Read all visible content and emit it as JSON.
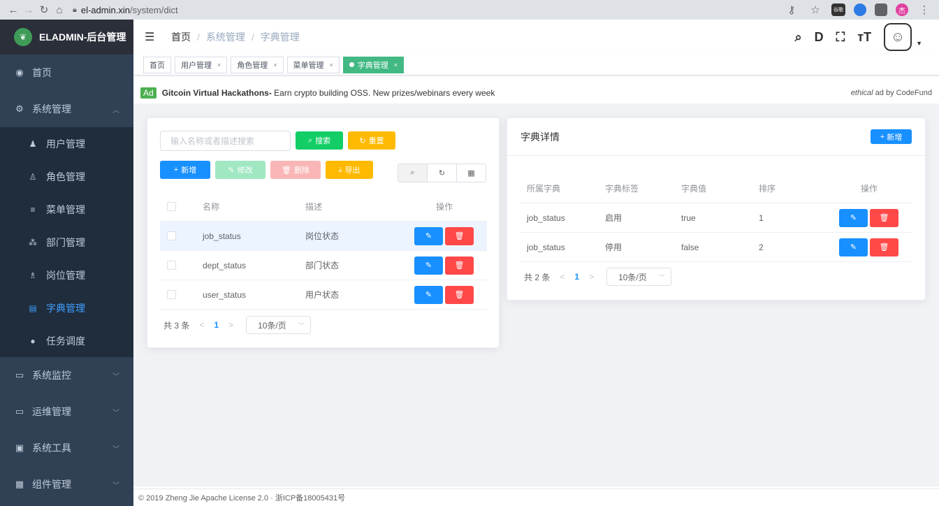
{
  "browser": {
    "url_host": "el-admin.xin",
    "url_path": "/system/dict",
    "ext_badge": "谷歌",
    "profile_initial": "杰"
  },
  "sidebar": {
    "logo_text": "ELADMIN-后台管理",
    "items": [
      {
        "label": "首页",
        "icon": "dashboard-icon"
      },
      {
        "label": "系统管理",
        "icon": "gear-icon",
        "expanded": true
      },
      {
        "label": "系统监控",
        "icon": "monitor-icon"
      },
      {
        "label": "运维管理",
        "icon": "ops-icon"
      },
      {
        "label": "系统工具",
        "icon": "tools-icon"
      },
      {
        "label": "组件管理",
        "icon": "components-icon"
      }
    ],
    "subitems": [
      {
        "label": "用户管理",
        "icon": "user-icon"
      },
      {
        "label": "角色管理",
        "icon": "role-icon"
      },
      {
        "label": "菜单管理",
        "icon": "menu-icon"
      },
      {
        "label": "部门管理",
        "icon": "dept-icon"
      },
      {
        "label": "岗位管理",
        "icon": "job-icon"
      },
      {
        "label": "字典管理",
        "icon": "dict-icon",
        "active": true
      },
      {
        "label": "任务调度",
        "icon": "timing-icon"
      }
    ]
  },
  "breadcrumb": [
    "首页",
    "系统管理",
    "字典管理"
  ],
  "tags": [
    "首页",
    "用户管理",
    "角色管理",
    "菜单管理",
    "字典管理"
  ],
  "ad": {
    "badge": "Ad",
    "headline": "Gitcoin Virtual Hackathons-",
    "text": " Earn crypto building OSS. New prizes/webinars every week",
    "right_em": "ethical",
    "right_text": " ad by CodeFund"
  },
  "dict": {
    "search_placeholder": "输入名称或者描述搜索",
    "search_label": "搜索",
    "reset_label": "重置",
    "add_label": "新增",
    "edit_label": "修改",
    "delete_label": "删除",
    "export_label": "导出",
    "columns": [
      "名称",
      "描述",
      "操作"
    ],
    "rows": [
      {
        "name": "job_status",
        "desc": "岗位状态"
      },
      {
        "name": "dept_status",
        "desc": "部门状态"
      },
      {
        "name": "user_status",
        "desc": "用户状态"
      }
    ],
    "total": "共 3 条",
    "page": "1",
    "page_size": "10条/页"
  },
  "detail": {
    "title": "字典详情",
    "add_label": "新增",
    "columns": [
      "所属字典",
      "字典标签",
      "字典值",
      "排序",
      "操作"
    ],
    "rows": [
      {
        "dict": "job_status",
        "label": "启用",
        "value": "true",
        "sort": "1"
      },
      {
        "dict": "job_status",
        "label": "停用",
        "value": "false",
        "sort": "2"
      }
    ],
    "total": "共 2 条",
    "page": "1",
    "page_size": "10条/页"
  },
  "footer": "© 2019 Zheng Jie Apache License 2.0 · 浙ICP备18005431号",
  "colors": {
    "sidebar_bg": "#304156",
    "active": "#409eff",
    "primary": "#1890ff",
    "success": "#13ce66",
    "warning": "#ffba00",
    "danger": "#ff4949",
    "tag_active": "#42b983"
  }
}
